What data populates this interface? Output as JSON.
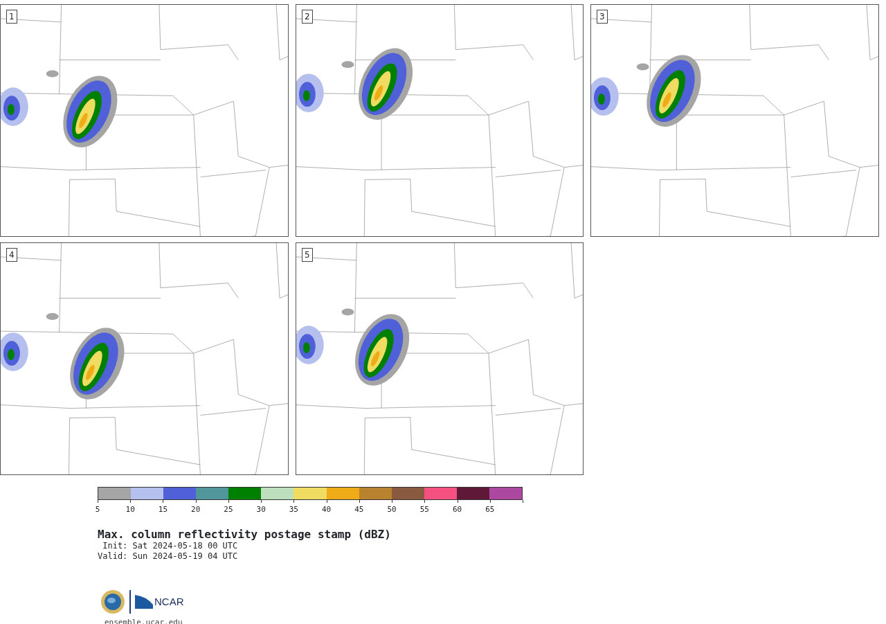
{
  "panels": [
    {
      "label": "1"
    },
    {
      "label": "2"
    },
    {
      "label": "3"
    },
    {
      "label": "4"
    },
    {
      "label": "5"
    }
  ],
  "colorbar": {
    "bins": [
      {
        "color": "#a5a5a5"
      },
      {
        "color": "#b6c0ee"
      },
      {
        "color": "#5060d8"
      },
      {
        "color": "#50969a"
      },
      {
        "color": "#008000"
      },
      {
        "color": "#bedfbe"
      },
      {
        "color": "#f0dc60"
      },
      {
        "color": "#f0ac18"
      },
      {
        "color": "#b8822e"
      },
      {
        "color": "#8a5a40"
      },
      {
        "color": "#f45080"
      },
      {
        "color": "#601838"
      },
      {
        "color": "#ac48a0"
      }
    ],
    "ticks": [
      "5",
      "10",
      "15",
      "20",
      "25",
      "30",
      "35",
      "40",
      "45",
      "50",
      "55",
      "60",
      "65"
    ]
  },
  "title": "Max. column reflectivity postage stamp (dBZ)",
  "init": " Init: Sat 2024-05-18 00 UTC",
  "valid": "Valid: Sun 2024-05-19 04 UTC",
  "logo_text": "NCAR",
  "url": "ensemble.ucar.edu"
}
